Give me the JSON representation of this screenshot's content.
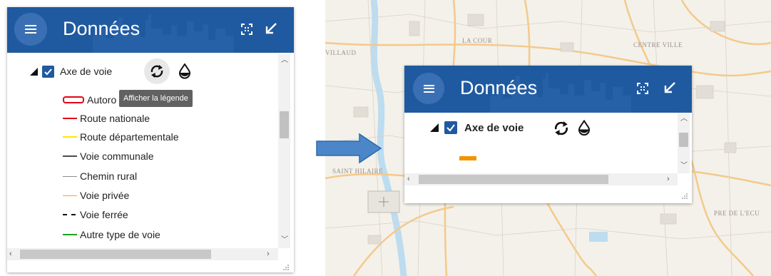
{
  "left_panel": {
    "title": "Données",
    "layer": {
      "name": "Axe de voie",
      "checked": true
    },
    "tooltip": "Afficher la légende",
    "legend": [
      {
        "label": "Autoro",
        "style": "red-outline"
      },
      {
        "label": "Route nationale",
        "color": "#e30613"
      },
      {
        "label": "Route départementale",
        "color": "#ffe800"
      },
      {
        "label": "Voie communale",
        "color": "#4d4d4d"
      },
      {
        "label": "Chemin rural",
        "color": "#8c8c8c"
      },
      {
        "label": "Voie privée",
        "color": "#f6a623"
      },
      {
        "label": "Voie ferrée",
        "style": "dashed-black"
      },
      {
        "label": "Autre type de voie",
        "color": "#1aa21a"
      }
    ]
  },
  "right_panel": {
    "title": "Données",
    "layer": {
      "name": "Axe de voie",
      "checked": true
    },
    "legend_swatch_color": "#f39200"
  },
  "map": {
    "labels": [
      "LA COUR",
      "CENTRE VILLE",
      "VILLAUD",
      "SAINT HILAIRE",
      "PRE DE L'ECU"
    ]
  },
  "colors": {
    "header_blue": "#1f5aa0",
    "arrow_blue": "#4a86c8"
  }
}
